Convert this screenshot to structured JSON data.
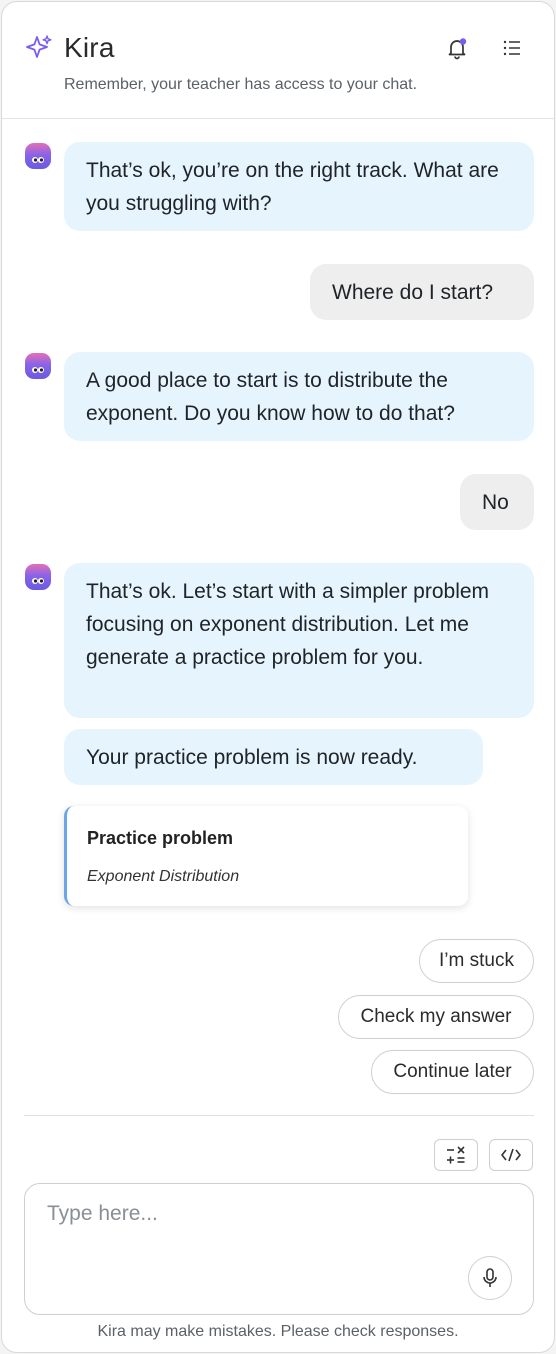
{
  "header": {
    "title": "Kira",
    "subtitle": "Remember, your teacher has access to your chat.",
    "brand_icon": "sparkle-icon",
    "bell_icon": "bell-icon",
    "menu_icon": "list-icon",
    "accent_color": "#7b5cf0"
  },
  "messages": [
    {
      "role": "bot",
      "text": "That’s ok, you’re on the right track. What are you struggling with?"
    },
    {
      "role": "user",
      "text": "Where do I start?"
    },
    {
      "role": "bot",
      "text": "A good place to start is to distribute the exponent. Do you know how to do that?"
    },
    {
      "role": "user",
      "text": "No"
    },
    {
      "role": "bot",
      "text": "That’s ok. Let’s start with a simpler problem focusing on exponent distribution. Let me generate a practice problem for you."
    },
    {
      "role": "bot",
      "text": "Your practice problem is now ready."
    }
  ],
  "practice_card": {
    "title": "Practice problem",
    "subtitle": "Exponent Distribution"
  },
  "quick_replies": [
    "I’m stuck",
    "Check my answer",
    "Continue later"
  ],
  "tools": {
    "math_icon": "math-symbols-icon",
    "code_icon": "code-icon"
  },
  "composer": {
    "placeholder": "Type here...",
    "value": "",
    "mic_icon": "microphone-icon"
  },
  "footer": {
    "disclaimer": "Kira may make mistakes. Please check responses."
  }
}
